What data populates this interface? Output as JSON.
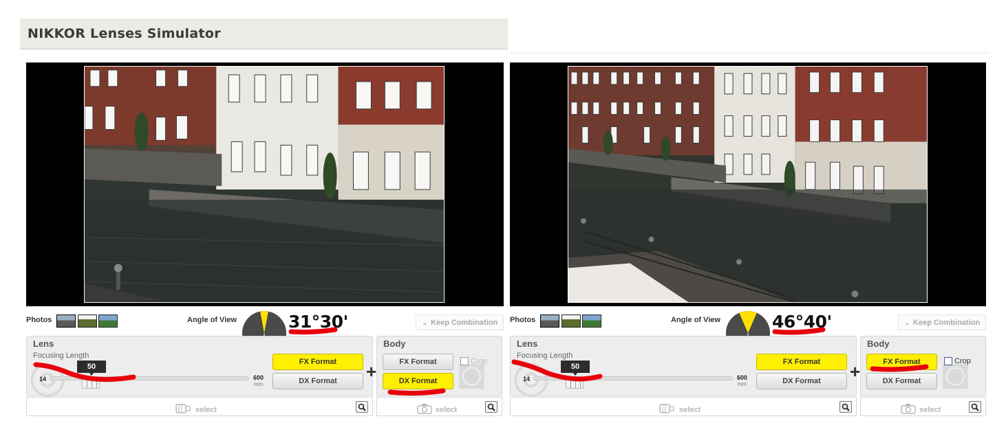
{
  "header": {
    "title": "NIKKOR Lenses Simulator"
  },
  "simulators": [
    {
      "id": "left",
      "photos_label": "Photos",
      "angle_of_view_label": "Angle of View",
      "angle_of_view_value": "31°30'",
      "keep_combination_label": "Keep Combination",
      "lens": {
        "title": "Lens",
        "focusing_length_label": "Focusing Length",
        "focal_value": "50",
        "focal_min": "14",
        "focal_max": "600",
        "focal_unit": "mm",
        "fx_label": "FX Format",
        "dx_label": "DX Format",
        "selected": "FX Format",
        "select_label": "select"
      },
      "body": {
        "title": "Body",
        "fx_label": "FX Format",
        "dx_label": "DX Format",
        "selected": "DX Format",
        "crop_label": "Crop",
        "crop_enabled": false,
        "select_label": "select"
      }
    },
    {
      "id": "right",
      "photos_label": "Photos",
      "angle_of_view_label": "Angle of View",
      "angle_of_view_value": "46°40'",
      "keep_combination_label": "Keep Combination",
      "lens": {
        "title": "Lens",
        "focusing_length_label": "Focusing Length",
        "focal_value": "50",
        "focal_min": "14",
        "focal_max": "600",
        "focal_unit": "mm",
        "fx_label": "FX Format",
        "dx_label": "DX Format",
        "selected": "FX Format",
        "select_label": "select"
      },
      "body": {
        "title": "Body",
        "fx_label": "FX Format",
        "dx_label": "DX Format",
        "selected": "FX Format",
        "crop_label": "Crop",
        "crop_enabled": true,
        "select_label": "select"
      }
    }
  ],
  "colors": {
    "accent_yellow": "#ffef00",
    "annotation_red": "#e8000b",
    "dial_gray": "#4a4a4a"
  },
  "icons": [
    "keep-combination-chevron-icon",
    "lens-icon",
    "camera-icon",
    "magnifier-icon",
    "angle-of-view-dial-icon"
  ]
}
